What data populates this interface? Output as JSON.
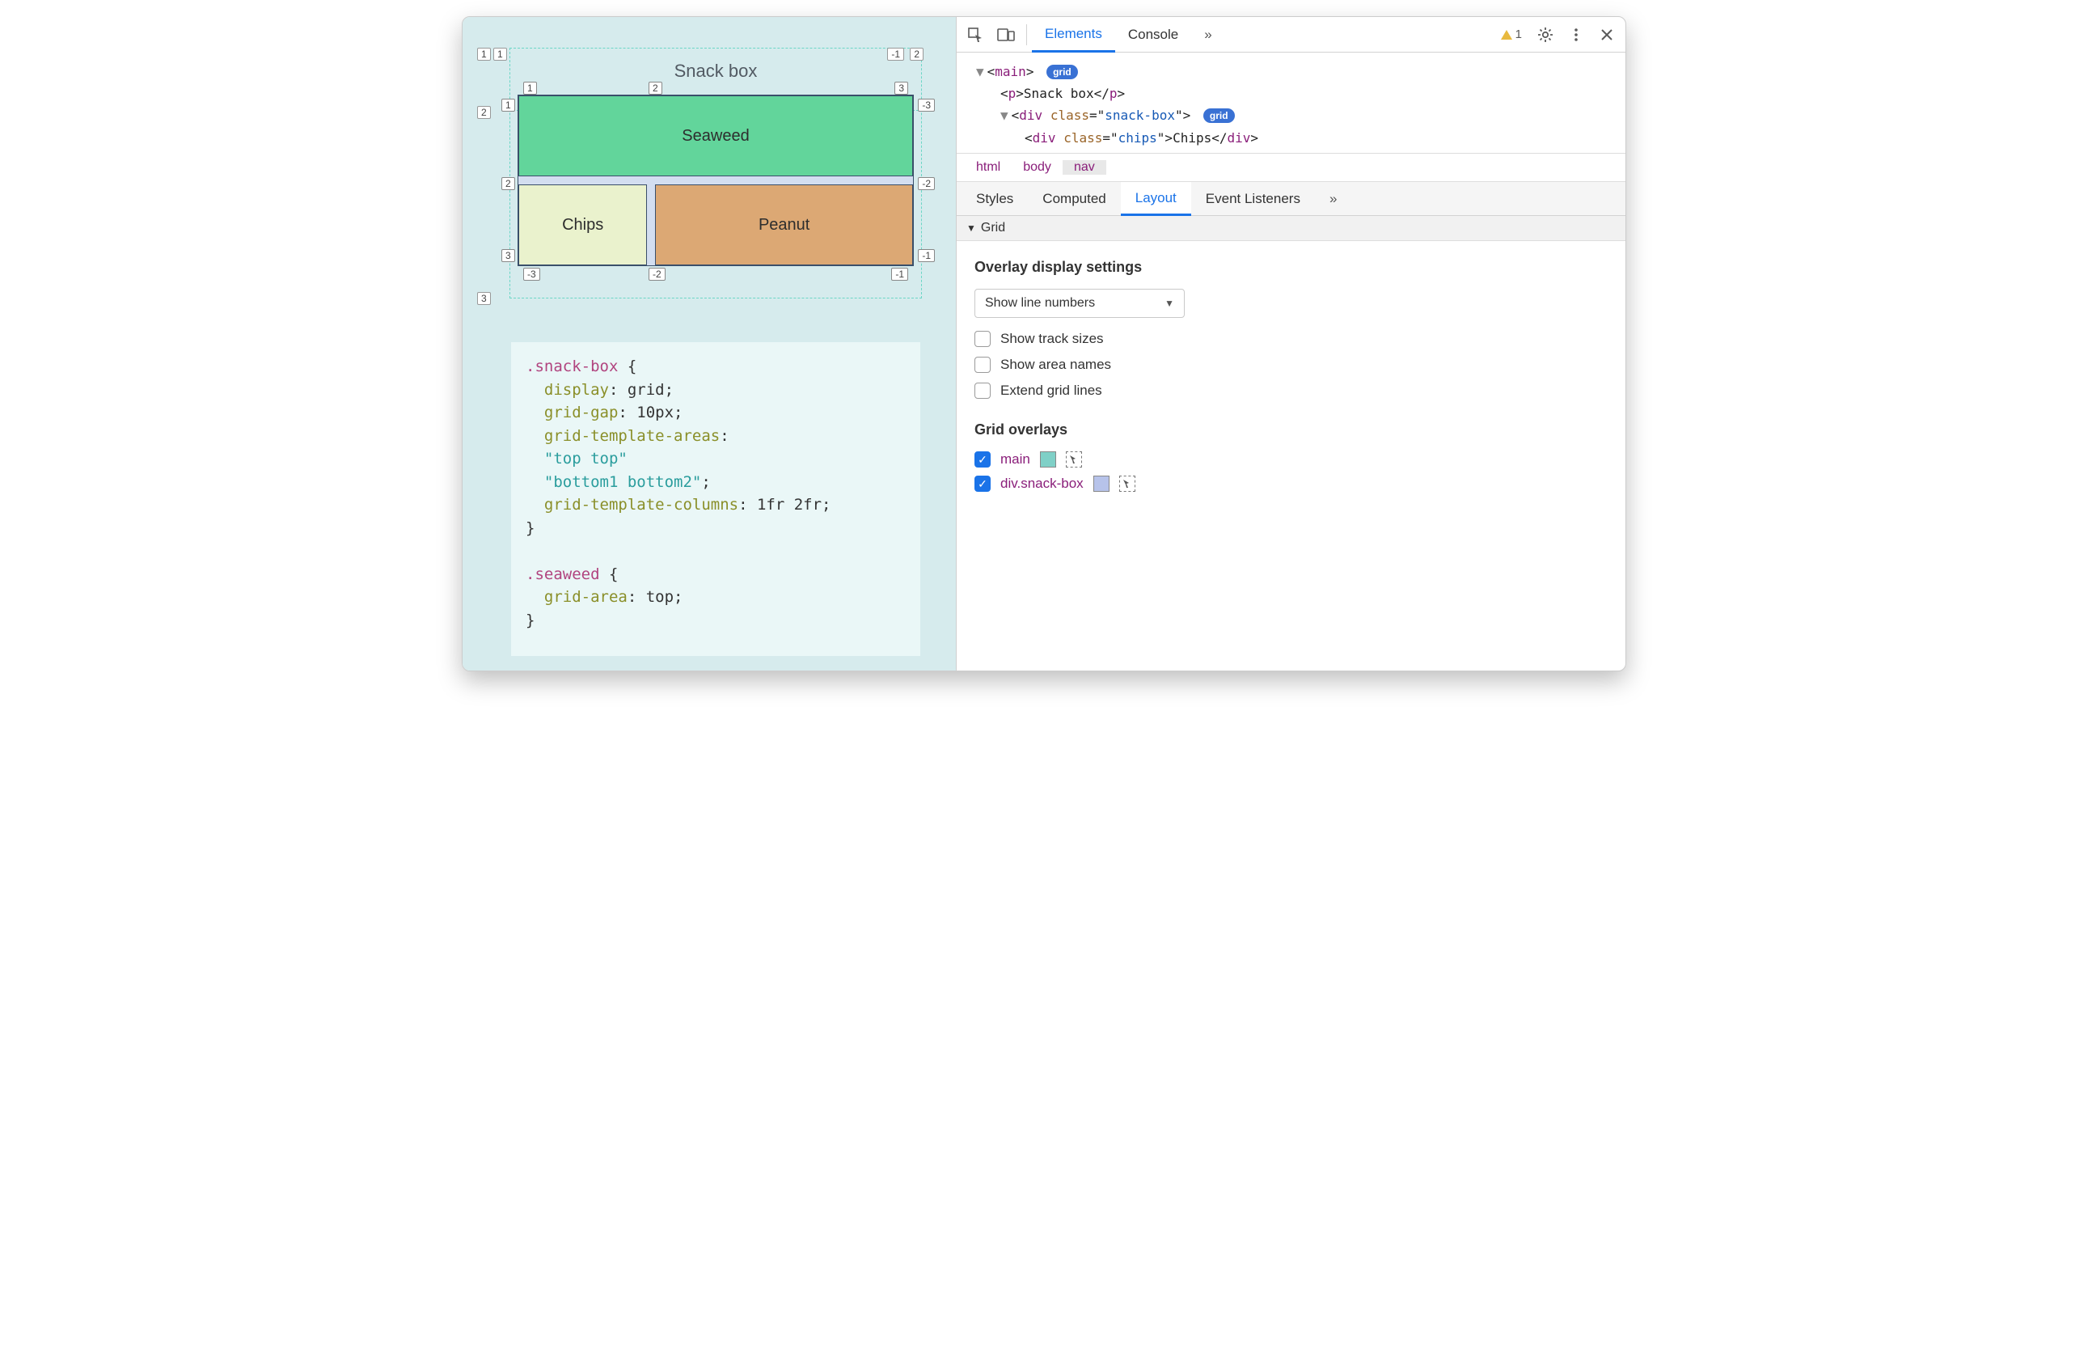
{
  "preview": {
    "title": "Snack box",
    "cells": {
      "seaweed": "Seaweed",
      "chips": "Chips",
      "peanut": "Peanut"
    },
    "outer_badges": {
      "tl_out": "1",
      "tl_in": "1",
      "tr_neg": "-1",
      "tr_end": "2",
      "row2": "2",
      "row3": "3"
    },
    "inner_badges": {
      "t1": "1",
      "t2": "2",
      "t3": "3",
      "l1": "1",
      "l2": "2",
      "l3": "3",
      "r1": "-3",
      "r2": "-2",
      "r3": "-1",
      "b1": "-3",
      "b2": "-2",
      "b3": "-1"
    },
    "code": ".snack-box {\n  display: grid;\n  grid-gap: 10px;\n  grid-template-areas:\n  \"top top\"\n  \"bottom1 bottom2\";\n  grid-template-columns: 1fr 2fr;\n}\n\n.seaweed {\n  grid-area: top;\n}"
  },
  "devtools": {
    "top_tabs": [
      "Elements",
      "Console"
    ],
    "more_glyph": "»",
    "warning_count": "1",
    "dom": {
      "l1": {
        "open": "▼",
        "tag": "main",
        "pill": "grid"
      },
      "l2": {
        "tag": "p",
        "text": "Snack box"
      },
      "l3": {
        "open": "▼",
        "tag": "div",
        "class": "snack-box",
        "pill": "grid"
      },
      "l4": {
        "tag": "div",
        "class": "chips",
        "text": "Chips"
      }
    },
    "breadcrumbs": [
      "html",
      "body",
      "nav"
    ],
    "sub_tabs": [
      "Styles",
      "Computed",
      "Layout",
      "Event Listeners"
    ],
    "grid_section": "Grid",
    "overlay_settings_title": "Overlay display settings",
    "line_numbers_select": "Show line numbers",
    "checkboxes": {
      "track_sizes": "Show track sizes",
      "area_names": "Show area names",
      "extend_lines": "Extend grid lines"
    },
    "grid_overlays_title": "Grid overlays",
    "overlays": [
      {
        "label": "main",
        "checked": true,
        "swatch": "main"
      },
      {
        "label": "div.snack-box",
        "checked": true,
        "swatch": "box"
      }
    ]
  }
}
